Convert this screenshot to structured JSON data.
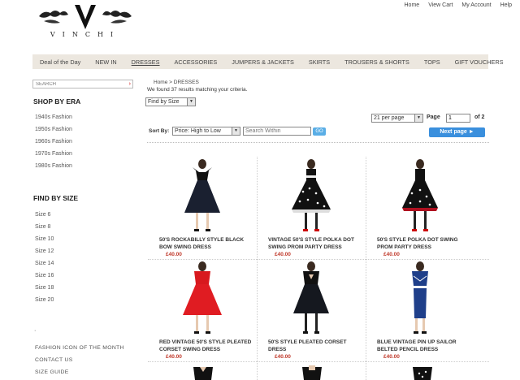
{
  "header": {
    "logo_text": "VINCHI",
    "top_links": [
      "Home",
      "View Cart",
      "My Account",
      "Help"
    ]
  },
  "nav": {
    "items": [
      "Deal of the Day",
      "NEW IN",
      "DRESSES",
      "ACCESSORIES",
      "JUMPERS & JACKETS",
      "SKIRTS",
      "TROUSERS & SHORTS",
      "TOPS",
      "GIFT VOUCHERS"
    ],
    "active": "DRESSES"
  },
  "sidebar": {
    "search_placeholder": "SEARCH",
    "era_heading": "SHOP BY ERA",
    "eras": [
      "1940s Fashion",
      "1950s Fashion",
      "1960s Fashion",
      "1970s Fashion",
      "1980s Fashion"
    ],
    "size_heading": "FIND BY SIZE",
    "sizes": [
      "Size 6",
      "Size 8",
      "Size 10",
      "Size 12",
      "Size 14",
      "Size 16",
      "Size 18",
      "Size 20"
    ],
    "footer_links": [
      "FASHION ICON OF THE MONTH",
      "CONTACT US",
      "SIZE GUIDE"
    ]
  },
  "main": {
    "breadcrumb": "Home > DRESSES",
    "results_text": "We found 37 results matching your criteria.",
    "find_by_size": "Find by Size",
    "per_page": "21 per page",
    "page_label": "Page",
    "page_value": "1",
    "page_total": "of 2",
    "sort_label": "Sort By:",
    "sort_value": "Price: High to Low",
    "search_within_placeholder": "Search Within",
    "go_label": "GO",
    "next_label": "Next page"
  },
  "products": [
    {
      "name": "50's ROCKABILLY STYLE BLACK BOW SWING DRESS",
      "price": "£40.00"
    },
    {
      "name": "VINTAGE 50's STYLE POLKA DOT SWING PROM PARTY DRESS",
      "price": "£40.00"
    },
    {
      "name": "50's STYLE POLKA DOT SWING PROM PARTY DRESS",
      "price": "£40.00"
    },
    {
      "name": "RED VINTAGE 50's STYLE PLEATED CORSET SWING DRESS",
      "price": "£40.00"
    },
    {
      "name": "50's STYLE PLEATED CORSET DRESS",
      "price": "£40.00"
    },
    {
      "name": "BLUE VINTAGE PIN UP SAILOR BELTED PENCIL DRESS",
      "price": "£40.00"
    }
  ],
  "colors": {
    "nav_bg": "#ece7df",
    "price": "#c0392b",
    "button_blue": "#3a8fdd"
  }
}
